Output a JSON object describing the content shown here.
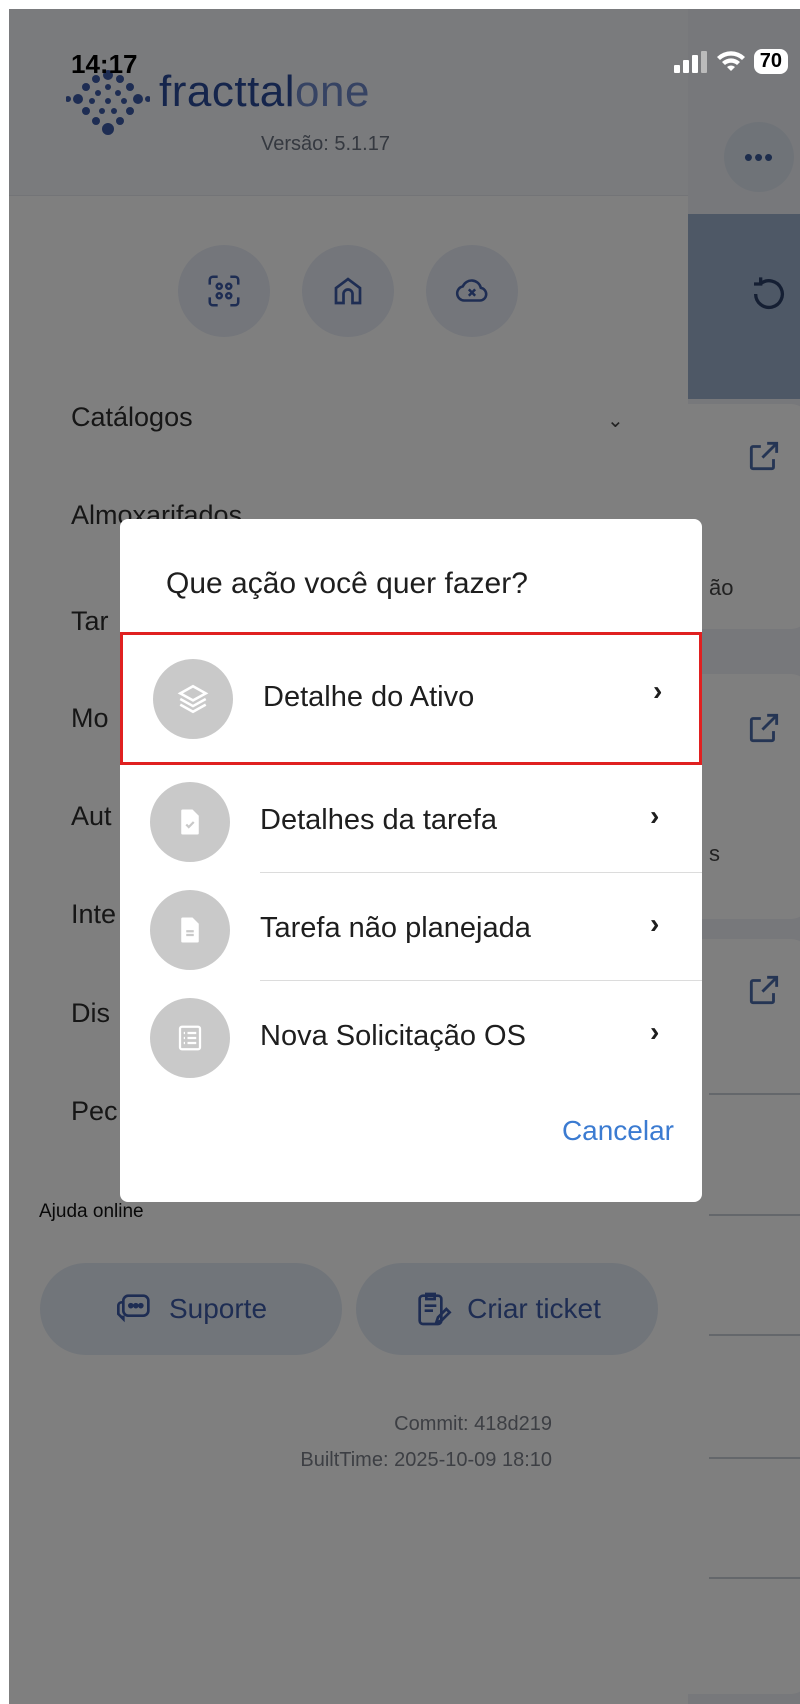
{
  "status_bar": {
    "time": "14:17",
    "battery": "70"
  },
  "drawer": {
    "logo": "fracttal one",
    "logo_main": "fracttal",
    "logo_accent": "one",
    "version": "Versão: 5.1.17",
    "menu": [
      {
        "label": "Catálogos"
      },
      {
        "label": "Almoxarifados"
      },
      {
        "label": "Tar"
      },
      {
        "label": "Mo"
      },
      {
        "label": "Aut"
      },
      {
        "label": "Inte"
      },
      {
        "label": "Dis"
      },
      {
        "label": "Pec"
      }
    ],
    "help_label": "Ajuda online",
    "support_label": "Suporte",
    "ticket_label": "Criar ticket",
    "commit": "Commit: 418d219",
    "built_time": "BuiltTime: 2025-10-09 18:10"
  },
  "background": {
    "fragment_1": "ão",
    "fragment_2": "s"
  },
  "dialog": {
    "title": "Que ação você quer fazer?",
    "options": [
      {
        "label": "Detalhe do Ativo",
        "icon": "layers-icon"
      },
      {
        "label": "Detalhes da tarefa",
        "icon": "file-check-icon"
      },
      {
        "label": "Tarefa não planejada",
        "icon": "file-text-icon"
      },
      {
        "label": "Nova Solicitação OS",
        "icon": "list-icon"
      }
    ],
    "cancel_label": "Cancelar"
  },
  "colors": {
    "brand": "#3d5aa6",
    "highlight": "#e02020",
    "link": "#3b7bd1"
  }
}
